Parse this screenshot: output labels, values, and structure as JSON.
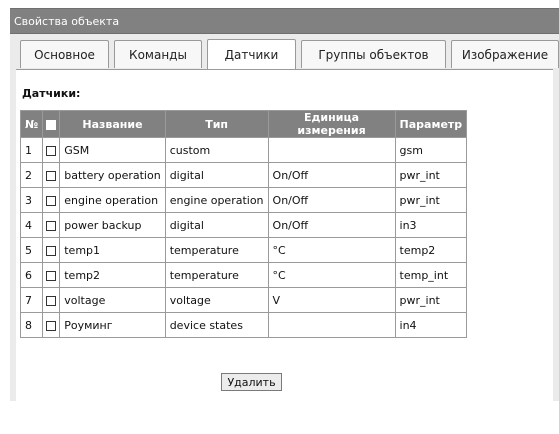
{
  "window": {
    "title": "Свойства объекта"
  },
  "tabs": [
    {
      "label": "Основное"
    },
    {
      "label": "Команды"
    },
    {
      "label": "Датчики"
    },
    {
      "label": "Группы объектов"
    },
    {
      "label": "Изображение"
    }
  ],
  "active_tab": "Датчики",
  "section": {
    "title": "Датчики:"
  },
  "table": {
    "headers": [
      "№",
      "",
      "Название",
      "Тип",
      "Единица измерения",
      "Параметр"
    ],
    "rows": [
      {
        "num": "1",
        "name": "GSM",
        "type": "custom",
        "unit": "",
        "param": "gsm"
      },
      {
        "num": "2",
        "name": "battery operation",
        "type": "digital",
        "unit": "On/Off",
        "param": "pwr_int"
      },
      {
        "num": "3",
        "name": "engine operation",
        "type": "engine operation",
        "unit": "On/Off",
        "param": "pwr_int"
      },
      {
        "num": "4",
        "name": "power backup",
        "type": "digital",
        "unit": "On/Off",
        "param": "in3"
      },
      {
        "num": "5",
        "name": "temp1",
        "type": "temperature",
        "unit": "°C",
        "param": "temp2"
      },
      {
        "num": "6",
        "name": "temp2",
        "type": "temperature",
        "unit": "°C",
        "param": "temp_int"
      },
      {
        "num": "7",
        "name": "voltage",
        "type": "voltage",
        "unit": "V",
        "param": "pwr_int"
      },
      {
        "num": "8",
        "name": "Роуминг",
        "type": "device states",
        "unit": "",
        "param": "in4"
      }
    ]
  },
  "actions": {
    "delete_label": "Удалить"
  },
  "colors": {
    "header_bg": "#818181",
    "panel_bg": "#ebebeb",
    "border": "#9a9a9a"
  }
}
